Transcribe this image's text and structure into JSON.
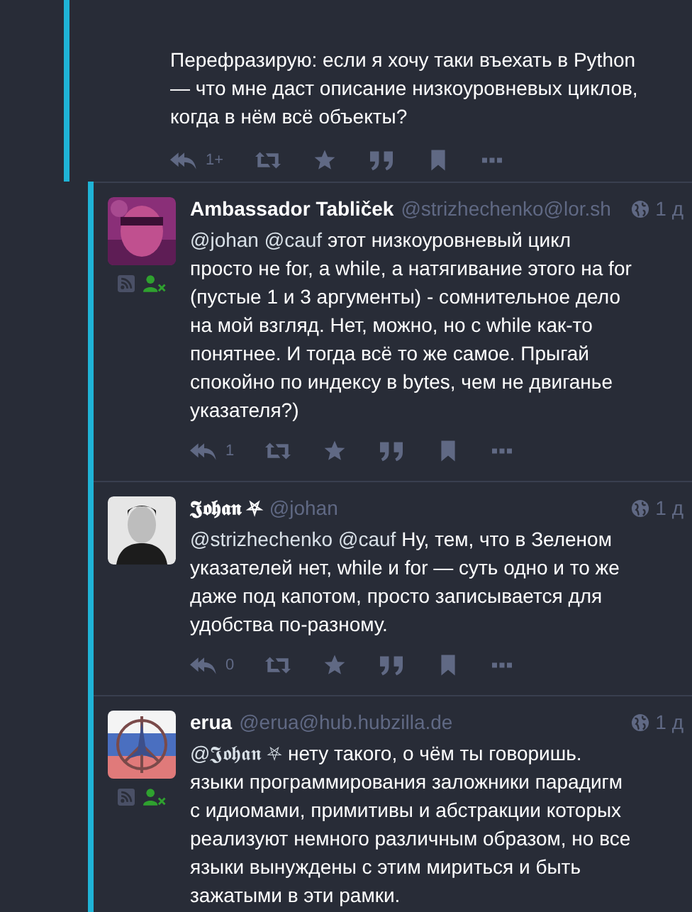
{
  "posts": [
    {
      "kind": "thread",
      "content": [
        {
          "kind": "text",
          "text": "Перефразирую: если я хочу таки въехать в Python\n— что мне даст описание низкоуровневых циклов,\nкогда в нём всё объекты?"
        }
      ],
      "actions": {
        "replies": "1+"
      }
    },
    {
      "kind": "reply",
      "avatar": {
        "kind": "picture"
      },
      "feed_icons": true,
      "name": "Ambassador Tabliček",
      "handle": "@strizhechenko@lor.sh",
      "time": "1 д",
      "content": [
        {
          "kind": "mention",
          "text": "@johan"
        },
        {
          "kind": "mention",
          "text": "@cauf"
        },
        {
          "kind": "text",
          "text": " этот низкоуровневый цикл\nпросто не for, а while, а натягивание этого на for\n(пустые 1 и 3 аргументы) - сомнительное дело\nна мой взгляд. Нет, можно, но с while как-то\nпонятнее. И тогда всё то же самое. Прыгай\nспокойно по индексу в bytes, чем не двиганье\nуказателя?)"
        }
      ],
      "actions": {
        "replies": "1"
      }
    },
    {
      "kind": "reply",
      "avatar": {
        "kind": "picture"
      },
      "feed_icons": false,
      "name": "𝕵𝖔𝖍𝖆𝖓 ⛧",
      "handle": "@johan",
      "time": "1 д",
      "content": [
        {
          "kind": "mention",
          "text": "@strizhechenko"
        },
        {
          "kind": "mention",
          "text": "@cauf"
        },
        {
          "kind": "text",
          "text": " Ну, тем, что в Зеленом\nуказателей нет, while и for — суть одно и то же\nдаже под капотом, просто записывается для\nудобства по-разному."
        }
      ],
      "actions": {
        "replies": "0"
      }
    },
    {
      "kind": "reply",
      "avatar": {
        "kind": "picture"
      },
      "feed_icons": true,
      "name": "erua",
      "handle": "@erua@hub.hubzilla.de",
      "time": "1 д",
      "content": [
        {
          "kind": "mention",
          "text": "@𝕵𝖔𝖍𝖆𝖓 ⛧"
        },
        {
          "kind": "text",
          "text": " нету такого, о чём ты говоришь.\nязыки программирования заложники парадигм\nс идиомами, примитивы и абстракции которых\nреализуют немного различным образом, но все\nязыки вынуждены с этим мириться и быть\nзажатыми в эти рамки."
        }
      ]
    }
  ]
}
